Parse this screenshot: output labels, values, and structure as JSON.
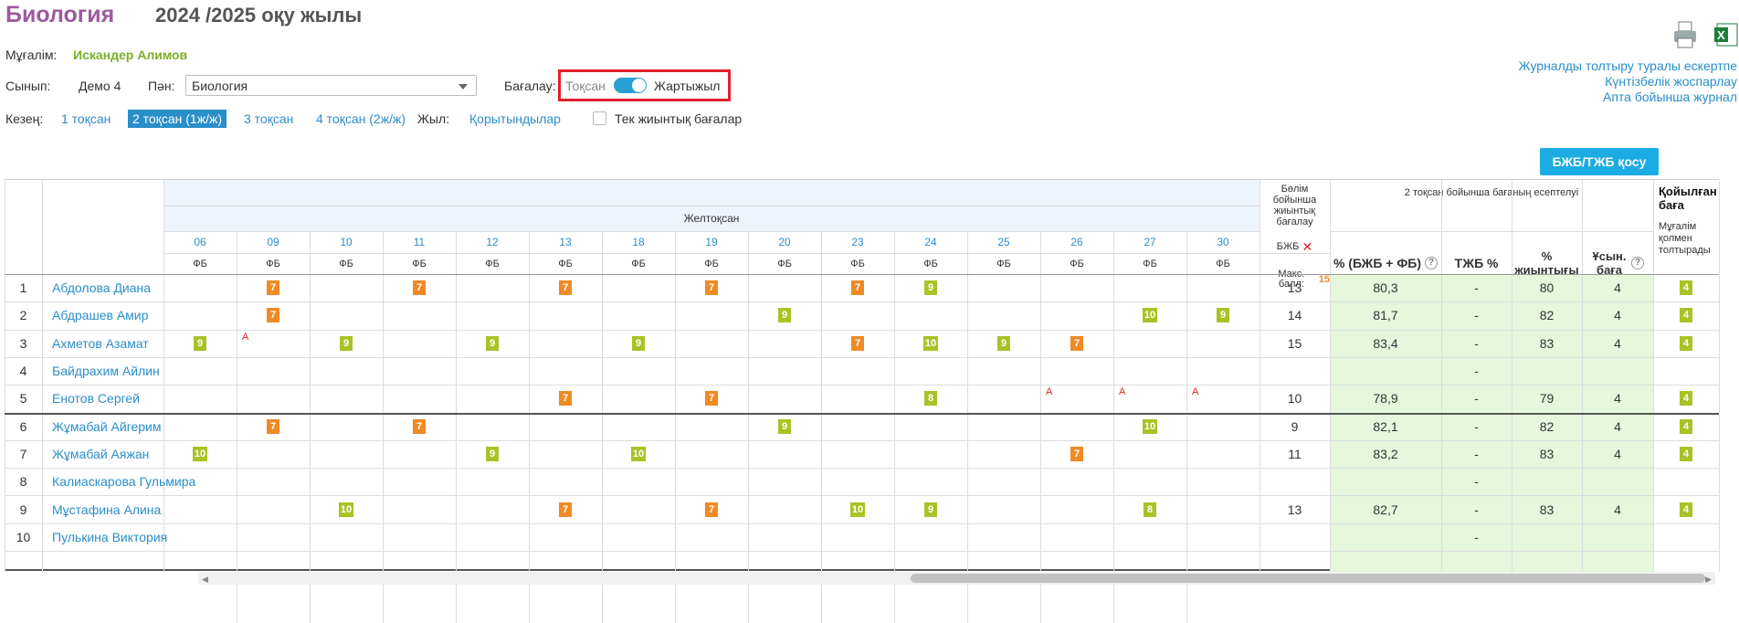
{
  "header": {
    "subject_title": "Биология",
    "year_title": "2024 /2025 оқу жылы"
  },
  "teacher": {
    "label": "Мұғалім:",
    "name": "Искандер Алимов"
  },
  "class": {
    "label": "Сынып:",
    "value": "Демо 4"
  },
  "subject": {
    "label": "Пән:",
    "selected": "Биология"
  },
  "grading": {
    "label": "Бағалау:",
    "left": "Тоқсан",
    "right": "Жартыжыл",
    "toggle_on": true
  },
  "period": {
    "label": "Кезең:",
    "items": [
      "1 тоқсан",
      "2 тоқсан (1ж/ж)",
      "3 тоқсан",
      "4 тоқсан (2ж/ж)"
    ],
    "active": 1
  },
  "year": {
    "label": "Жыл:",
    "value": "Қорытындылар"
  },
  "summary_only": {
    "label": "Тек жиынтық бағалар",
    "checked": false
  },
  "add_button": "БЖБ/ТЖБ қосу",
  "right_links": [
    "Журналды толтыру туралы ескертпе",
    "Күнтізбелік жоспарлау",
    "Апта бойынша журнал"
  ],
  "icons": {
    "print": "printer-icon",
    "excel": "excel-icon"
  },
  "table": {
    "month": "Желтоқсан",
    "dates": [
      "06",
      "09",
      "10",
      "11",
      "12",
      "13",
      "18",
      "19",
      "20",
      "23",
      "24",
      "25",
      "26",
      "27",
      "30"
    ],
    "type": "ФБ",
    "bjb_header": "Бөлім бойынша жиынтық бағалау",
    "bjb_label": "БЖБ",
    "max_label": "Макс. балл:",
    "max_value": "15",
    "calc_header": "2 тоқсан бойынша бағаның есептелуі",
    "col_pct": "% (БЖБ + ФБ)",
    "col_tjb": "ТЖБ %",
    "col_total": "% жиынтығы",
    "col_suggest": "Ұсын. баға",
    "final_header": "Қойылған баға",
    "final_sub": "Мұғалім қолмен толтырады",
    "rows": [
      {
        "n": "1",
        "name": "Абдолова Диана",
        "marks": {
          "09": [
            "7",
            "o"
          ],
          "11": [
            "7",
            "o"
          ],
          "13": [
            "7",
            "o"
          ],
          "19": [
            "7",
            "o"
          ],
          "23": [
            "7",
            "o"
          ],
          "24": [
            "9",
            "g"
          ]
        },
        "bjb": "13",
        "pct": "80,3",
        "tjb": "-",
        "total": "80",
        "sug": "4",
        "fin": "4"
      },
      {
        "n": "2",
        "name": "Абдрашев Амир",
        "marks": {
          "09": [
            "7",
            "o"
          ],
          "20": [
            "9",
            "g"
          ],
          "27": [
            "10",
            "g"
          ],
          "30": [
            "9",
            "g"
          ]
        },
        "bjb": "14",
        "pct": "81,7",
        "tjb": "-",
        "total": "82",
        "sug": "4",
        "fin": "4"
      },
      {
        "n": "3",
        "name": "Ахметов Азамат",
        "marks": {
          "06": [
            "9",
            "g"
          ],
          "09": [
            "А",
            "a"
          ],
          "10": [
            "9",
            "g"
          ],
          "12": [
            "9",
            "g"
          ],
          "18": [
            "9",
            "g"
          ],
          "23": [
            "7",
            "o"
          ],
          "24": [
            "10",
            "g"
          ],
          "25": [
            "9",
            "g"
          ],
          "26": [
            "7",
            "o"
          ]
        },
        "bjb": "15",
        "pct": "83,4",
        "tjb": "-",
        "total": "83",
        "sug": "4",
        "fin": "4"
      },
      {
        "n": "4",
        "name": "Байдрахим Айлин",
        "marks": {},
        "bjb": "",
        "pct": "",
        "tjb": "-",
        "total": "",
        "sug": "",
        "fin": ""
      },
      {
        "n": "5",
        "name": "Енотов Сергей",
        "marks": {
          "13": [
            "7",
            "o"
          ],
          "19": [
            "7",
            "o"
          ],
          "24": [
            "8",
            "g"
          ],
          "26": [
            "А",
            "a"
          ],
          "27": [
            "А",
            "a"
          ],
          "30": [
            "А",
            "a"
          ]
        },
        "bjb": "10",
        "pct": "78,9",
        "tjb": "-",
        "total": "79",
        "sug": "4",
        "fin": "4"
      },
      {
        "n": "6",
        "name": "Жұмабай Айгерим",
        "marks": {
          "09": [
            "7",
            "o"
          ],
          "11": [
            "7",
            "o"
          ],
          "20": [
            "9",
            "g"
          ],
          "27": [
            "10",
            "g"
          ]
        },
        "bjb": "9",
        "pct": "82,1",
        "tjb": "-",
        "total": "82",
        "sug": "4",
        "fin": "4"
      },
      {
        "n": "7",
        "name": "Жұмабай Аяжан",
        "marks": {
          "06": [
            "10",
            "g"
          ],
          "12": [
            "9",
            "g"
          ],
          "18": [
            "10",
            "g"
          ],
          "26": [
            "7",
            "o"
          ]
        },
        "bjb": "11",
        "pct": "83,2",
        "tjb": "-",
        "total": "83",
        "sug": "4",
        "fin": "4"
      },
      {
        "n": "8",
        "name": "Калиаскарова Гульмира",
        "marks": {},
        "bjb": "",
        "pct": "",
        "tjb": "-",
        "total": "",
        "sug": "",
        "fin": ""
      },
      {
        "n": "9",
        "name": "Мұстафина Алина",
        "marks": {
          "10": [
            "10",
            "g"
          ],
          "13": [
            "7",
            "o"
          ],
          "19": [
            "7",
            "o"
          ],
          "23": [
            "10",
            "g"
          ],
          "24": [
            "9",
            "g"
          ],
          "27": [
            "8",
            "g"
          ]
        },
        "bjb": "13",
        "pct": "82,7",
        "tjb": "-",
        "total": "83",
        "sug": "4",
        "fin": "4"
      },
      {
        "n": "10",
        "name": "Пулькина Виктория",
        "marks": {},
        "bjb": "",
        "pct": "",
        "tjb": "-",
        "total": "",
        "sug": "",
        "fin": ""
      }
    ]
  }
}
